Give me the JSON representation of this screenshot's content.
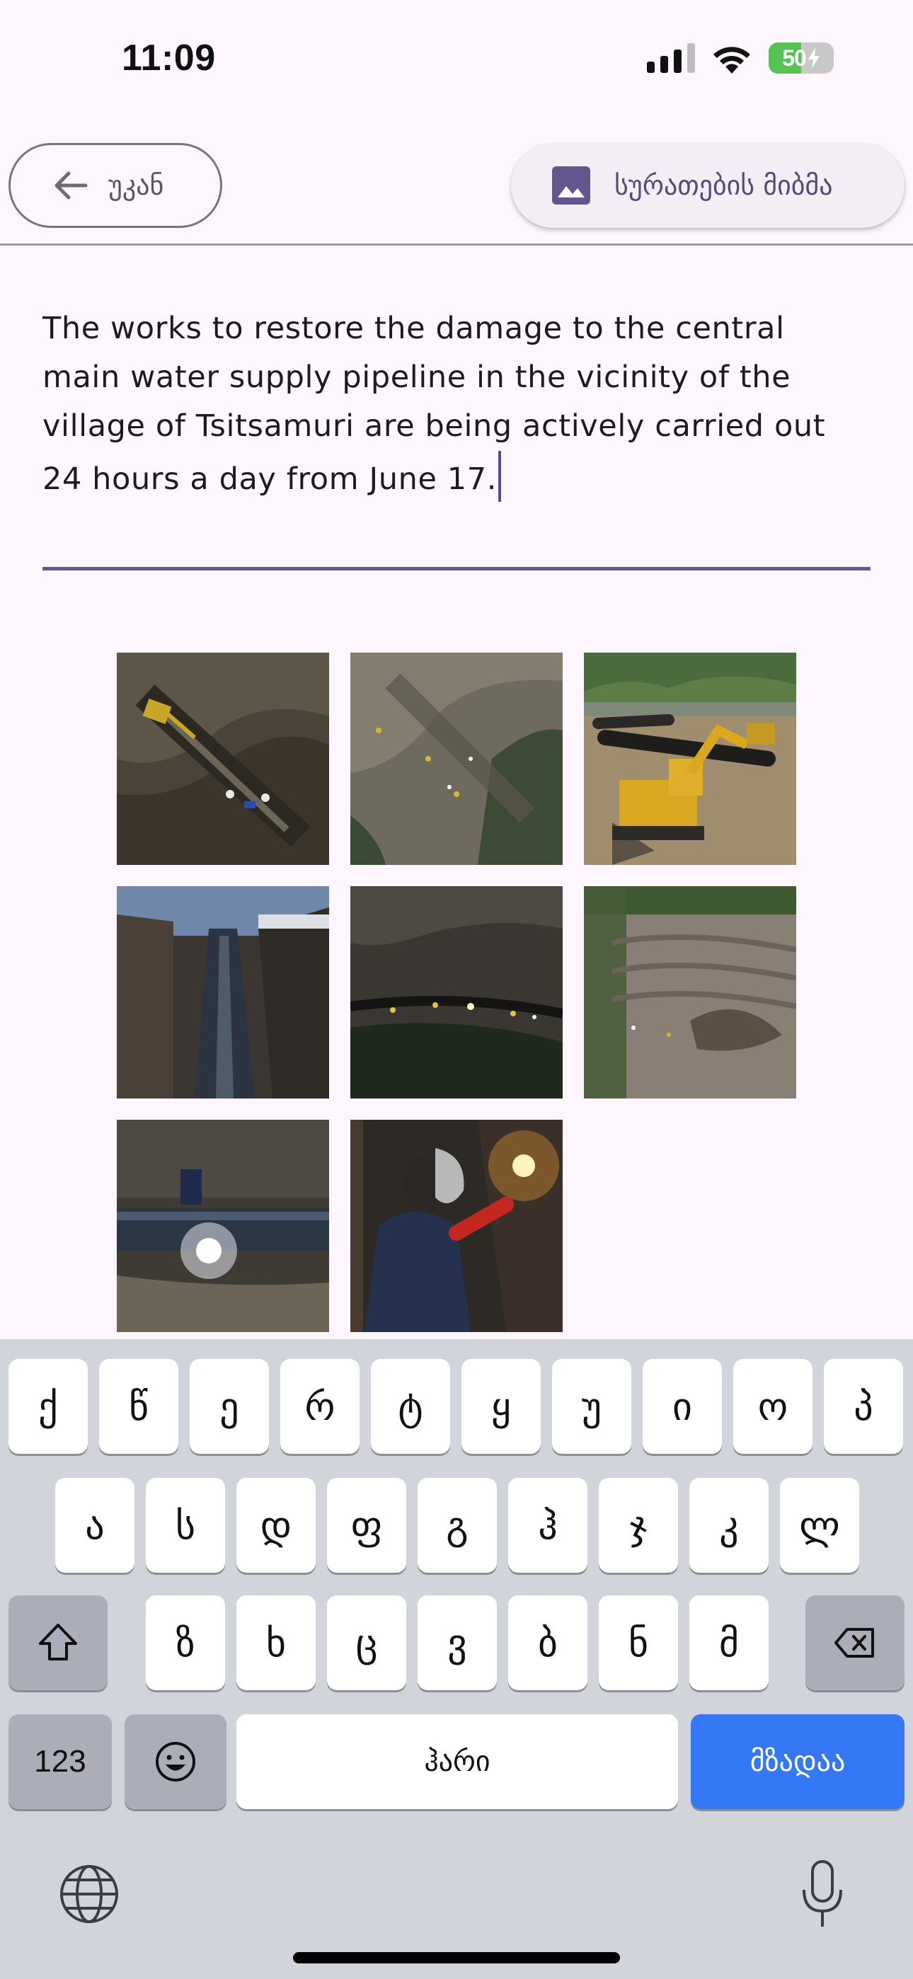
{
  "status_bar": {
    "time": "11:09",
    "battery_level": "50",
    "icons": [
      "cellular-signal-icon",
      "wifi-icon",
      "battery-charging-icon"
    ]
  },
  "app_bar": {
    "back_label": "უკან",
    "back_icon": "arrow-left-icon",
    "pick_images_label": "სურათების მიბმა",
    "pick_images_icon": "image-icon",
    "accent_color": "#65558f"
  },
  "text_field": {
    "value": "The works to restore the damage to the central main water supply pipeline in the vicinity of the village of Tsitsamuri are being actively carried out 24 hours a day from June 17."
  },
  "images": [
    {
      "subject": "excavator-trench-aerial"
    },
    {
      "subject": "construction-site-aerial"
    },
    {
      "subject": "yellow-excavator-pipes"
    },
    {
      "subject": "large-pipeline-trench"
    },
    {
      "subject": "night-aerial-site"
    },
    {
      "subject": "terraced-excavation-aerial"
    },
    {
      "subject": "pipe-welding-night"
    },
    {
      "subject": "welder-at-work"
    }
  ],
  "keyboard": {
    "row1": [
      "ქ",
      "წ",
      "ე",
      "რ",
      "ტ",
      "ყ",
      "უ",
      "ი",
      "ო",
      "პ"
    ],
    "row2": [
      "ა",
      "ს",
      "დ",
      "ფ",
      "გ",
      "ჰ",
      "ჯ",
      "კ",
      "ლ"
    ],
    "row3": [
      "ზ",
      "ხ",
      "ც",
      "ვ",
      "ბ",
      "ნ",
      "მ"
    ],
    "numbers_label": "123",
    "space_label": "ჰარი",
    "return_label": "მზადაა",
    "icons": [
      "shift-icon",
      "backspace-icon",
      "emoji-icon",
      "globe-icon",
      "microphone-icon"
    ]
  }
}
